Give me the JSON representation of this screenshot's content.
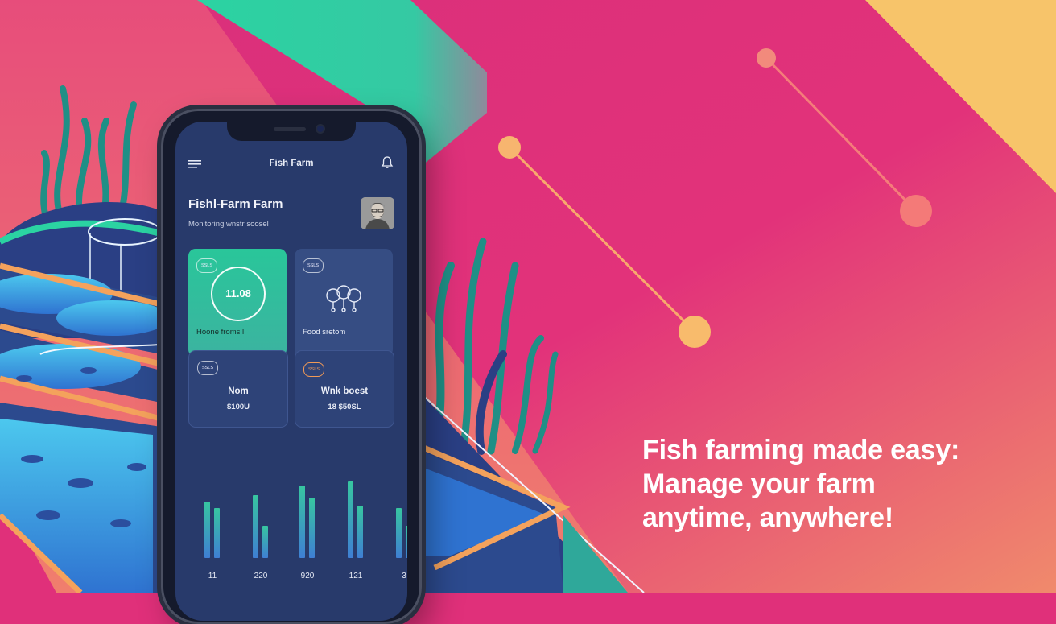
{
  "app": {
    "title": "Fish Farm",
    "farm_name": "Fishl-Farm Farm",
    "subtitle": "Monitoring wnstr soosel"
  },
  "cards": [
    {
      "badge": "SSLS",
      "value": "11.08",
      "label": "Hoone froms l"
    },
    {
      "badge": "SSLS",
      "label": "Food sretom"
    },
    {
      "badge": "SSLS",
      "title": "Nom",
      "value": "$100U"
    },
    {
      "badge": "SSLS",
      "title": "Wnk boest",
      "value": "18 $50SL"
    }
  ],
  "chart_data": {
    "type": "bar",
    "categories": [
      "11",
      "220",
      "920",
      "121",
      "3"
    ],
    "series": [
      {
        "values": [
          70,
          78,
          90,
          95,
          62
        ]
      },
      {
        "values": [
          62,
          40,
          75,
          65,
          40
        ]
      }
    ],
    "ylim": [
      0,
      100
    ],
    "colors": [
      "#3f7fd4",
      "#37c6a0"
    ]
  },
  "headline": {
    "line1": "Fish farming made easy:",
    "line2": "Manage your farm",
    "line3": "anytime, anywhere!"
  },
  "colors": {
    "background_pink": "#e0307a",
    "teal": "#2fd6a4",
    "yellow": "#f7c46a",
    "screen_navy": "#283a6b"
  }
}
